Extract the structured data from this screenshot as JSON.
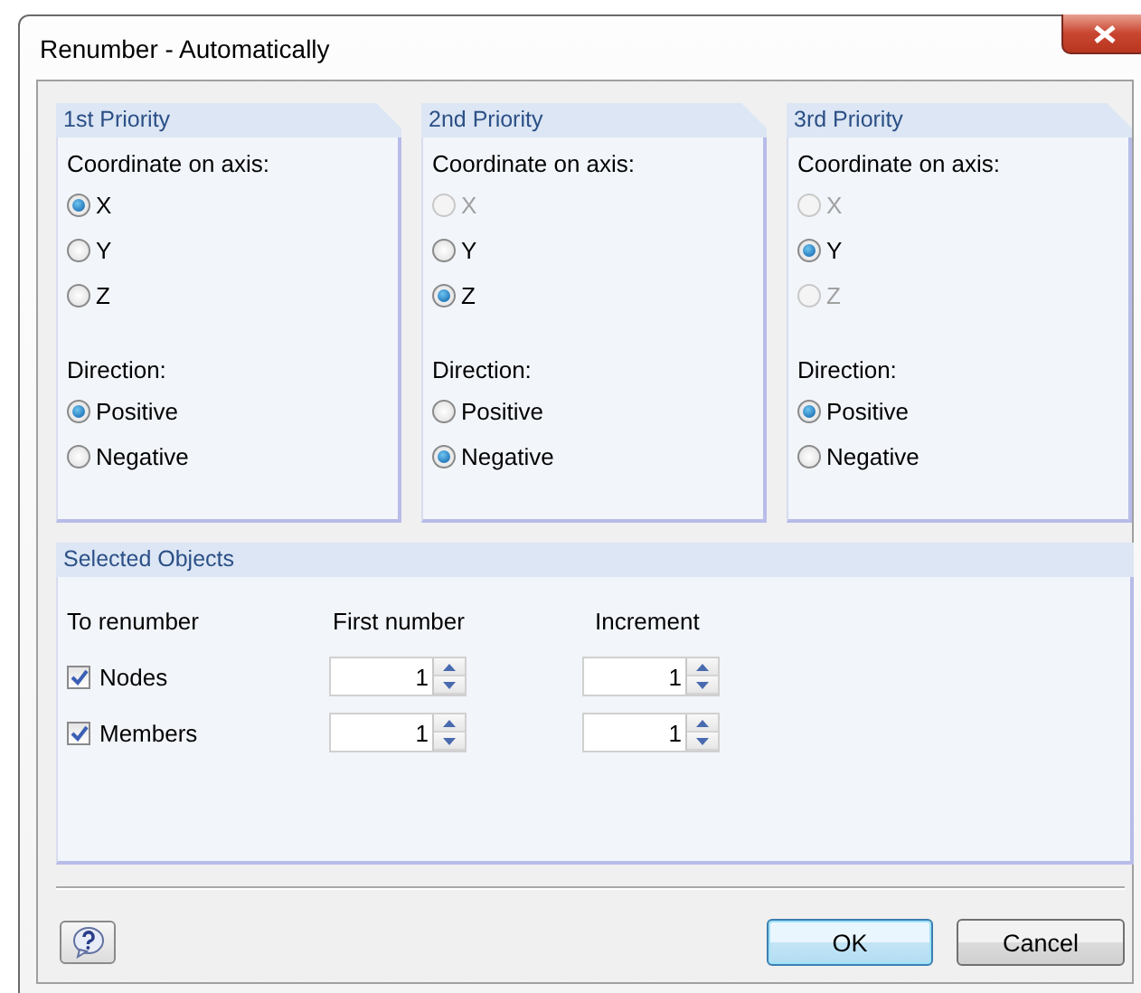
{
  "window": {
    "title": "Renumber - Automatically"
  },
  "priorities": [
    {
      "title": "1st Priority",
      "axis_label": "Coordinate on axis:",
      "axes": [
        {
          "label": "X",
          "selected": true,
          "disabled": false
        },
        {
          "label": "Y",
          "selected": false,
          "disabled": false
        },
        {
          "label": "Z",
          "selected": false,
          "disabled": false
        }
      ],
      "direction_label": "Direction:",
      "directions": [
        {
          "label": "Positive",
          "selected": true
        },
        {
          "label": "Negative",
          "selected": false
        }
      ]
    },
    {
      "title": "2nd Priority",
      "axis_label": "Coordinate on axis:",
      "axes": [
        {
          "label": "X",
          "selected": false,
          "disabled": true
        },
        {
          "label": "Y",
          "selected": false,
          "disabled": false
        },
        {
          "label": "Z",
          "selected": true,
          "disabled": false
        }
      ],
      "direction_label": "Direction:",
      "directions": [
        {
          "label": "Positive",
          "selected": false
        },
        {
          "label": "Negative",
          "selected": true
        }
      ]
    },
    {
      "title": "3rd Priority",
      "axis_label": "Coordinate on axis:",
      "axes": [
        {
          "label": "X",
          "selected": false,
          "disabled": true
        },
        {
          "label": "Y",
          "selected": true,
          "disabled": false
        },
        {
          "label": "Z",
          "selected": false,
          "disabled": true
        }
      ],
      "direction_label": "Direction:",
      "directions": [
        {
          "label": "Positive",
          "selected": true
        },
        {
          "label": "Negative",
          "selected": false
        }
      ]
    }
  ],
  "selected_objects": {
    "title": "Selected Objects",
    "columns": [
      "To renumber",
      "First number",
      "Increment"
    ],
    "rows": [
      {
        "label": "Nodes",
        "checked": true,
        "first_number": "1",
        "increment": "1"
      },
      {
        "label": "Members",
        "checked": true,
        "first_number": "1",
        "increment": "1"
      }
    ]
  },
  "buttons": [
    {
      "label": "OK",
      "default": true
    },
    {
      "label": "Cancel",
      "default": false
    }
  ]
}
